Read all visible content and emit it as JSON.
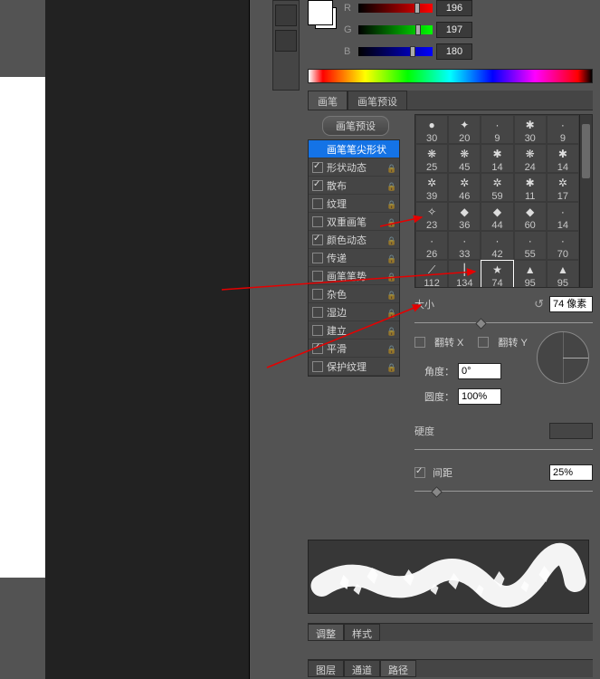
{
  "rgb": {
    "r_label": "R",
    "g_label": "G",
    "b_label": "B",
    "r": "196",
    "g": "197",
    "b": "180"
  },
  "tabs": {
    "brush": "画笔",
    "brush_presets": "画笔预设"
  },
  "preset_button": "画笔预设",
  "dyn": {
    "tip_shape": "画笔笔尖形状",
    "shape_dynamics": "形状动态",
    "scattering": "散布",
    "texture": "纹理",
    "dual_brush": "双重画笔",
    "color_dynamics": "颜色动态",
    "transfer": "传递",
    "brush_pose": "画笔笔势",
    "noise": "杂色",
    "wet_edges": "湿边",
    "buildup": "建立",
    "smoothing": "平滑",
    "protect_texture": "保护纹理"
  },
  "dyn_checked": {
    "shape_dynamics": true,
    "scattering": true,
    "color_dynamics": true,
    "smoothing": true
  },
  "brush_sizes": [
    "30",
    "20",
    "9",
    "30",
    "9",
    "25",
    "45",
    "14",
    "24",
    "14",
    "39",
    "46",
    "59",
    "11",
    "17",
    "23",
    "36",
    "44",
    "60",
    "14",
    "26",
    "33",
    "42",
    "55",
    "70",
    "112",
    "134",
    "74",
    "95",
    "95"
  ],
  "settings": {
    "size_label": "大小",
    "size_value": "74 像素",
    "flip_x": "翻转 X",
    "flip_y": "翻转 Y",
    "angle_label": "角度：",
    "angle_value": "0°",
    "roundness_label": "圆度：",
    "roundness_value": "100%",
    "hardness_label": "硬度",
    "spacing_label": "间距",
    "spacing_value": "25%"
  },
  "bottom": {
    "adjust": "调整",
    "styles": "样式",
    "layers": "图层",
    "channels": "通道",
    "paths": "路径"
  }
}
